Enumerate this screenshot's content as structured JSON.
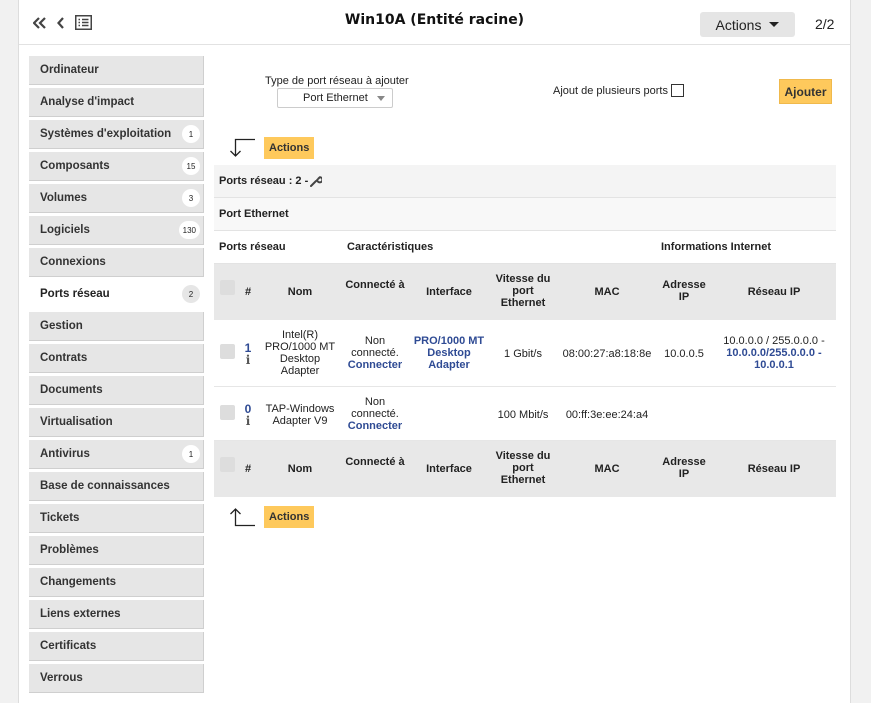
{
  "header": {
    "title": "Win10A (Entité racine)",
    "actions_label": "Actions",
    "pager": "2/2"
  },
  "sidebar": {
    "items": [
      {
        "label": "Ordinateur",
        "badge": "",
        "active": false
      },
      {
        "label": "Analyse d'impact",
        "badge": "",
        "active": false
      },
      {
        "label": "Systèmes d'exploitation",
        "badge": "1",
        "active": false
      },
      {
        "label": "Composants",
        "badge": "15",
        "active": false
      },
      {
        "label": "Volumes",
        "badge": "3",
        "active": false
      },
      {
        "label": "Logiciels",
        "badge": "130",
        "active": false
      },
      {
        "label": "Connexions",
        "badge": "",
        "active": false
      },
      {
        "label": "Ports réseau",
        "badge": "2",
        "active": true
      },
      {
        "label": "Gestion",
        "badge": "",
        "active": false
      },
      {
        "label": "Contrats",
        "badge": "",
        "active": false
      },
      {
        "label": "Documents",
        "badge": "",
        "active": false
      },
      {
        "label": "Virtualisation",
        "badge": "",
        "active": false
      },
      {
        "label": "Antivirus",
        "badge": "1",
        "active": false
      },
      {
        "label": "Base de connaissances",
        "badge": "",
        "active": false
      },
      {
        "label": "Tickets",
        "badge": "",
        "active": false
      },
      {
        "label": "Problèmes",
        "badge": "",
        "active": false
      },
      {
        "label": "Changements",
        "badge": "",
        "active": false
      },
      {
        "label": "Liens externes",
        "badge": "",
        "active": false
      },
      {
        "label": "Certificats",
        "badge": "",
        "active": false
      },
      {
        "label": "Verrous",
        "badge": "",
        "active": false
      }
    ]
  },
  "add_port": {
    "type_label": "Type de port réseau à ajouter",
    "type_value": "Port Ethernet",
    "multi_label": "Ajout de plusieurs ports",
    "add_label": "Ajouter"
  },
  "mass_actions_label": "Actions",
  "table": {
    "count_label": "Ports réseau : 2 -",
    "section_label": "Port Ethernet",
    "group_headers": {
      "ports": "Ports réseau",
      "characteristics": "Caractéristiques",
      "internet": "Informations Internet"
    },
    "columns": {
      "num": "#",
      "name": "Nom",
      "connected": "Connecté à",
      "interface": "Interface",
      "speed": "Vitesse du port Ethernet",
      "mac": "MAC",
      "ip": "Adresse IP",
      "network": "Réseau IP"
    },
    "rows": [
      {
        "num": "1",
        "info": "i",
        "name": "Intel(R) PRO/1000 MT Desktop Adapter",
        "connected_status": "Non connecté.",
        "connect_link": "Connecter",
        "interface": "PRO/1000 MT Desktop Adapter",
        "speed": "1 Gbit/s",
        "mac": "08:00:27:a8:18:8e",
        "ip": "10.0.0.5",
        "network_text": "10.0.0.0 / 255.0.0.0 -",
        "network_link": "10.0.0.0/255.0.0.0 - 10.0.0.1"
      },
      {
        "num": "0",
        "info": "i",
        "name": "TAP-Windows Adapter V9",
        "connected_status": "Non connecté.",
        "connect_link": "Connecter",
        "interface": "",
        "speed": "100 Mbit/s",
        "mac": "00:ff:3e:ee:24:a4",
        "ip": "",
        "network_text": "",
        "network_link": ""
      }
    ]
  },
  "icons": {
    "first": "double-chevron-left-icon",
    "prev": "chevron-left-icon",
    "list": "list-icon",
    "wrench": "wrench-icon"
  },
  "colors": {
    "accent_button": "#fec95c",
    "link": "#2f4b94",
    "sidebar_item": "#e6e6e6"
  }
}
